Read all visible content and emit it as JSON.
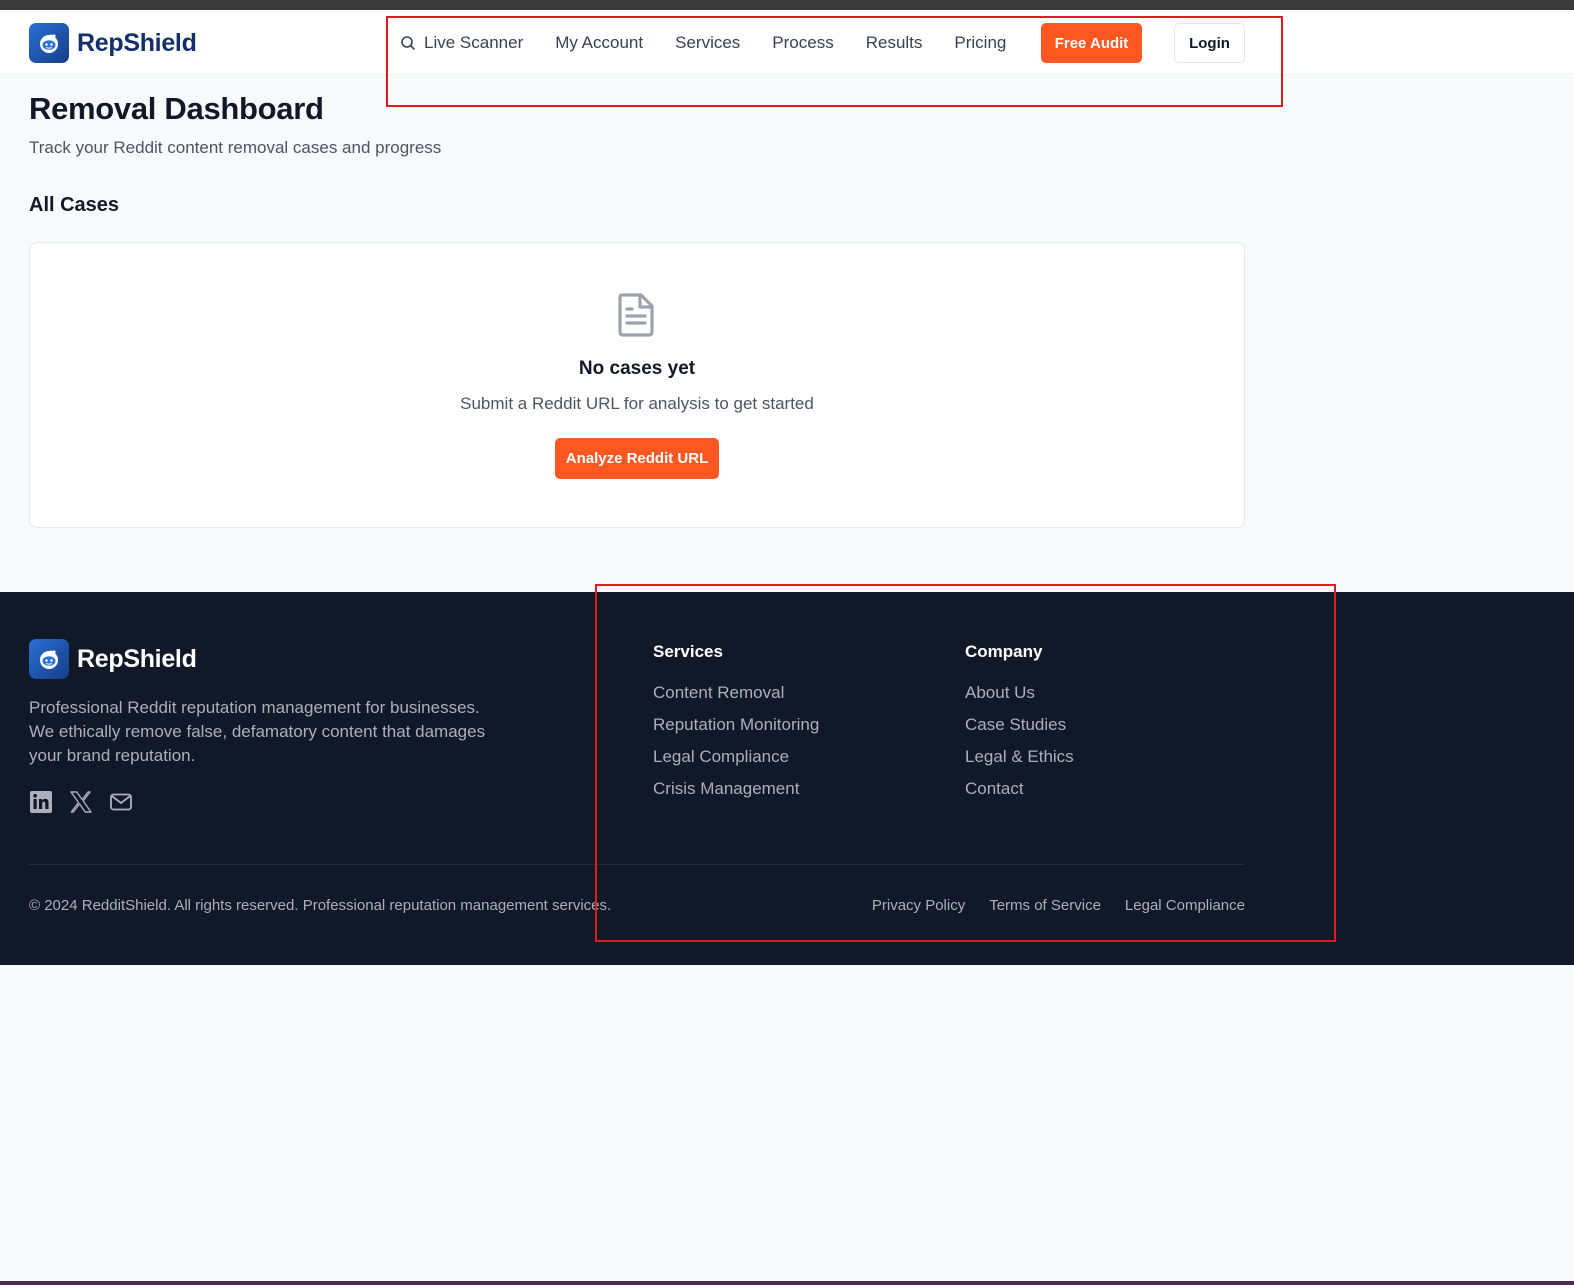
{
  "brand": {
    "name": "RepShield"
  },
  "nav": {
    "items": [
      {
        "label": "Live Scanner",
        "icon": "search-icon"
      },
      {
        "label": "My Account"
      },
      {
        "label": "Services"
      },
      {
        "label": "Process"
      },
      {
        "label": "Results"
      },
      {
        "label": "Pricing"
      }
    ],
    "cta_label": "Free Audit",
    "login_label": "Login"
  },
  "main": {
    "title": "Removal Dashboard",
    "subtitle": "Track your Reddit content removal cases and progress",
    "section_title": "All Cases",
    "empty_state": {
      "icon": "document-icon",
      "title": "No cases yet",
      "subtitle": "Submit a Reddit URL for analysis to get started",
      "button_label": "Analyze Reddit URL"
    }
  },
  "footer": {
    "description": "Professional Reddit reputation management for businesses. We ethically remove false, defamatory content that damages your brand reputation.",
    "social_icons": [
      "linkedin-icon",
      "x-icon",
      "mail-icon"
    ],
    "columns": [
      {
        "heading": "Services",
        "links": [
          "Content Removal",
          "Reputation Monitoring",
          "Legal Compliance",
          "Crisis Management"
        ]
      },
      {
        "heading": "Company",
        "links": [
          "About Us",
          "Case Studies",
          "Legal & Ethics",
          "Contact"
        ]
      }
    ],
    "copyright": "© 2024 RedditShield. All rights reserved. Professional reputation management services.",
    "legal_links": [
      "Privacy Policy",
      "Terms of Service",
      "Legal Compliance"
    ]
  },
  "colors": {
    "accent": "#ff5722",
    "brand_blue": "#13306b",
    "footer_bg": "#111827",
    "annotation": "#e01b24"
  }
}
